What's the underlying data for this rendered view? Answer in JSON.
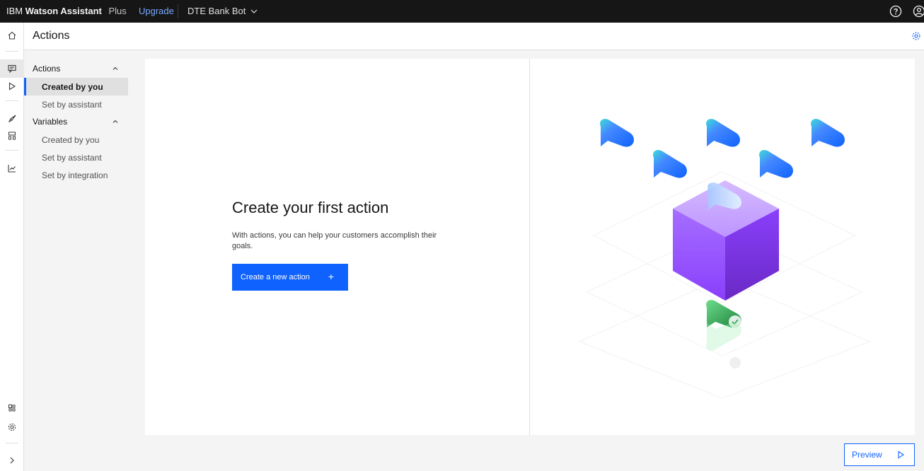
{
  "topbar": {
    "brand_ibm": "IBM",
    "brand_product": "Watson Assistant",
    "plan": "Plus",
    "upgrade": "Upgrade",
    "bot_name": "DTE Bank Bot",
    "icons": [
      "help-icon",
      "user-profile-icon"
    ]
  },
  "header": {
    "title": "Actions",
    "settings_icon": "gear-icon"
  },
  "rail": {
    "icons": [
      "home-icon",
      "actions-icon",
      "preview-icon",
      "publish-icon",
      "environments-icon",
      "analytics-icon",
      "integrations-icon",
      "settings-icon",
      "expand-icon"
    ]
  },
  "sidebar": {
    "groups": [
      {
        "label": "Actions",
        "items": [
          {
            "label": "Created by you",
            "active": true
          },
          {
            "label": "Set by assistant",
            "active": false
          }
        ]
      },
      {
        "label": "Variables",
        "items": [
          {
            "label": "Created by you",
            "active": false
          },
          {
            "label": "Set by assistant",
            "active": false
          },
          {
            "label": "Set by integration",
            "active": false
          }
        ]
      }
    ]
  },
  "empty_state": {
    "title": "Create your first action",
    "description": "With actions, you can help your customers accomplish their goals.",
    "button_label": "Create a new action",
    "button_icon": "+"
  },
  "preview": {
    "label": "Preview"
  },
  "colors": {
    "accent": "#0f62fe",
    "topbar": "#161616",
    "link": "#78a9ff"
  }
}
